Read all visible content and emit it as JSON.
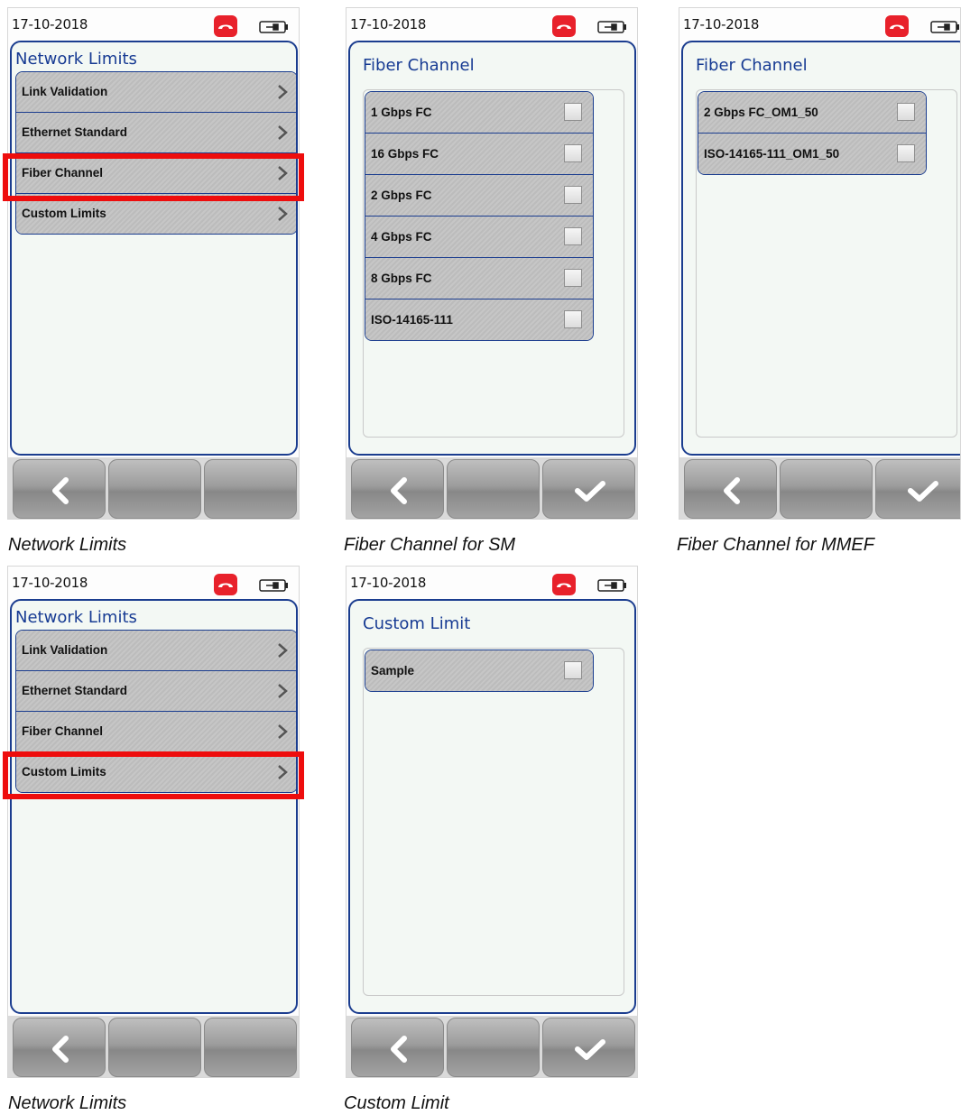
{
  "device": {
    "date": "17-10-2018"
  },
  "screens": {
    "network_limits_1": {
      "title": "Network Limits",
      "items": [
        "Link Validation",
        "Ethernet Standard",
        "Fiber Channel",
        "Custom Limits"
      ],
      "highlighted": "Fiber Channel"
    },
    "fiber_sm": {
      "title": "Fiber Channel",
      "options": [
        "1 Gbps FC",
        "16 Gbps FC",
        "2 Gbps FC",
        "4 Gbps FC",
        "8 Gbps FC",
        "ISO-14165-111"
      ]
    },
    "fiber_mmef": {
      "title": "Fiber Channel",
      "options": [
        "2 Gbps FC_OM1_50",
        "ISO-14165-111_OM1_50"
      ]
    },
    "network_limits_2": {
      "title": "Network Limits",
      "items": [
        "Link Validation",
        "Ethernet Standard",
        "Fiber Channel",
        "Custom Limits"
      ],
      "highlighted": "Custom Limits"
    },
    "custom_limit": {
      "title": "Custom Limit",
      "options": [
        "Sample"
      ]
    }
  },
  "captions": {
    "c1": "Network Limits",
    "c2": "Fiber Channel for SM",
    "c3": "Fiber Channel for MMEF",
    "c4": "Network Limits",
    "c5": "Custom Limit"
  },
  "icons": {
    "status": [
      "phone-icon",
      "battery-plug-icon"
    ],
    "toolbar": [
      "back-icon",
      "check-icon"
    ],
    "menu_arrow": "chevron-right-icon"
  },
  "colors": {
    "accent": "#1b3d8f",
    "highlight": "#ee0d0d",
    "phone": "#e8212b"
  }
}
